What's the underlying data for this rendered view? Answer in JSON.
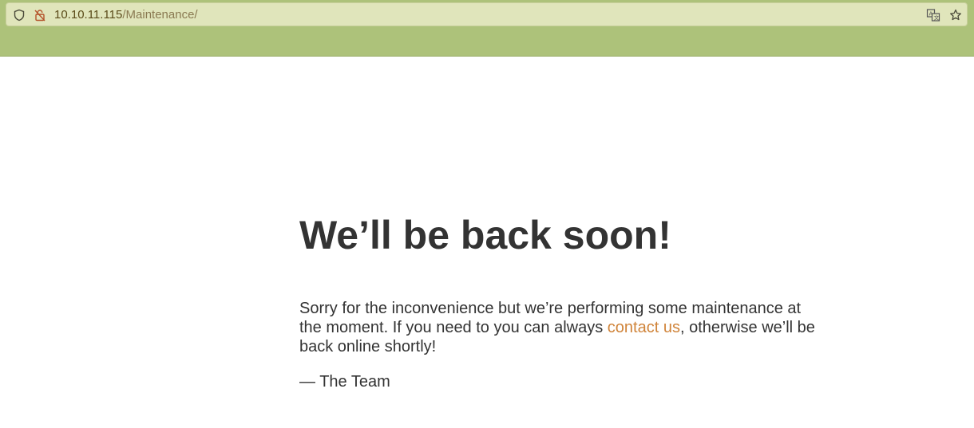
{
  "browser": {
    "url_host": "10.10.11.115",
    "url_path": "/Maintenance/",
    "icons": [
      "shield-icon",
      "insecure-lock-icon",
      "translate-icon",
      "bookmark-star-icon"
    ],
    "chrome_color": "#adc27a",
    "urlbar_color": "#e0e5bb"
  },
  "page": {
    "headline": "We’ll be back soon!",
    "message_before_link": "Sorry for the inconvenience but we’re performing some maintenance at the moment. If you need to you can always ",
    "link_text": "contact us",
    "message_after_link": ", otherwise we’ll be back online shortly!",
    "signature": "— The Team",
    "text_color": "#333333",
    "link_color": "#d0843a"
  }
}
